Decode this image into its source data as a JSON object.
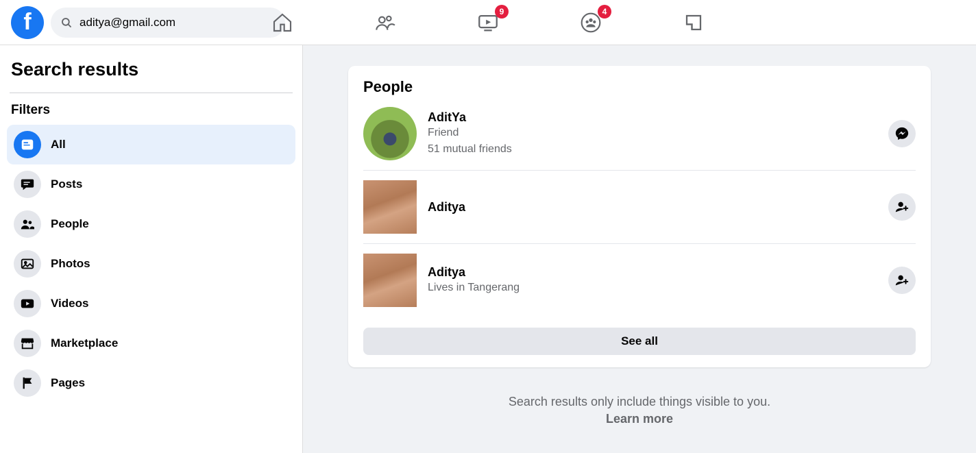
{
  "search": {
    "value": "aditya@gmail.com"
  },
  "topnav": {
    "watch_badge": "9",
    "groups_badge": "4"
  },
  "sidebar": {
    "title": "Search results",
    "filters_heading": "Filters",
    "items": [
      {
        "label": "All",
        "icon": "feed"
      },
      {
        "label": "Posts",
        "icon": "posts"
      },
      {
        "label": "People",
        "icon": "people"
      },
      {
        "label": "Photos",
        "icon": "photos"
      },
      {
        "label": "Videos",
        "icon": "videos"
      },
      {
        "label": "Marketplace",
        "icon": "marketplace"
      },
      {
        "label": "Pages",
        "icon": "pages"
      }
    ]
  },
  "results": {
    "section_title": "People",
    "people": [
      {
        "name": "AditYa",
        "sub1": "Friend",
        "sub2": "51 mutual friends",
        "action": "message",
        "avatar_style": "round"
      },
      {
        "name": "Aditya",
        "sub1": "",
        "sub2": "",
        "action": "add-friend",
        "avatar_style": "sq"
      },
      {
        "name": "Aditya",
        "sub1": "Lives in Tangerang",
        "sub2": "",
        "action": "add-friend",
        "avatar_style": "sq"
      }
    ],
    "see_all": "See all"
  },
  "footer": {
    "note": "Search results only include things visible to you.",
    "learn": "Learn more"
  }
}
